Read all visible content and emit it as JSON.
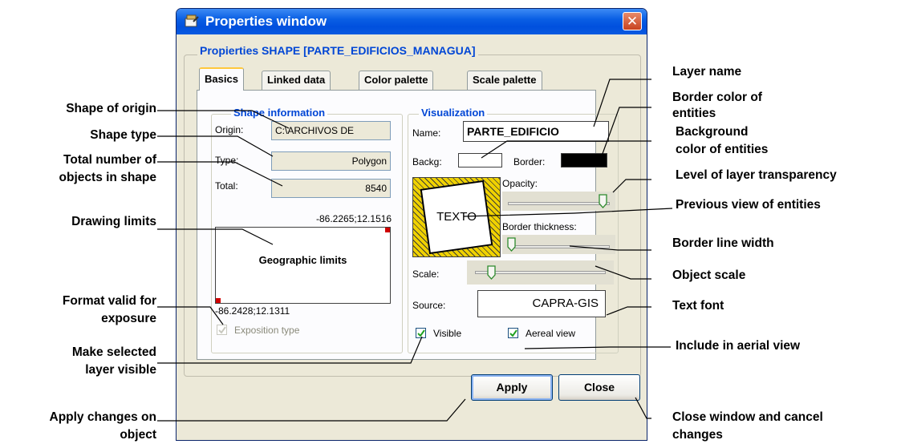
{
  "window": {
    "title": "Properties window",
    "close_symbol": "✕",
    "group_title": "Propierties SHAPE [PARTE_EDIFICIOS_MANAGUA]",
    "tabs": [
      {
        "label": "Basics",
        "active": true
      },
      {
        "label": "Linked data",
        "active": false
      },
      {
        "label": "Color palette",
        "active": false
      },
      {
        "label": "Scale palette",
        "active": false
      }
    ],
    "shape_info": {
      "title": "Shape information",
      "origin_label": "Origin:",
      "origin_value": "C:\\ARCHIVOS DE",
      "type_label": "Type:",
      "type_value": "Polygon",
      "total_label": "Total:",
      "total_value": "8540",
      "limit_max": "-86.2265;12.1516",
      "limit_box_label": "Geographic limits",
      "limit_min": "-86.2428;12.1311",
      "exposition_label": "Exposition type",
      "exposition_checked": true
    },
    "visualization": {
      "title": "Visualization",
      "name_label": "Name:",
      "name_value": "PARTE_EDIFICIO",
      "backg_label": "Backg:",
      "border_label": "Border:",
      "preview_text": "TEXTO",
      "opacity_label": "Opacity:",
      "opacity_level": 0.95,
      "border_thickness_label": "Border thickness:",
      "border_thickness_level": 0.0,
      "scale_label": "Scale:",
      "scale_level": 0.1,
      "source_label": "Source:",
      "source_value": "CAPRA-GIS",
      "visible_label": "Visible",
      "visible_checked": true,
      "aerial_label": "Aereal view",
      "aerial_checked": true
    },
    "buttons": {
      "apply": "Apply",
      "close": "Close"
    }
  },
  "annotations": {
    "shape_of_origin": "Shape of origin",
    "shape_type": "Shape type",
    "total_objects_1": "Total number of",
    "total_objects_2": "objects in shape",
    "drawing_limits": "Drawing limits",
    "format_valid_1": "Format valid for",
    "format_valid_2": "exposure",
    "make_visible_1": "Make selected",
    "make_visible_2": "layer visible",
    "apply_changes_1": "Apply changes on",
    "apply_changes_2": "object",
    "layer_name": "Layer name",
    "border_color_1": "Border color of",
    "border_color_2": "entities",
    "background_color_1": "Background",
    "background_color_2": "color of entities",
    "transparency": "Level of layer transparency",
    "previous_view": "Previous view of entities",
    "border_width": "Border line width",
    "object_scale": "Object scale",
    "text_font": "Text font",
    "aerial_view": "Include in aerial view",
    "close_window_1": "Close window and cancel",
    "close_window_2": "changes"
  },
  "colors": {
    "title_blue": "#0a5fe4",
    "group_title_blue": "#0046d5",
    "close_red": "#c8421f",
    "border_swatch": "#000000",
    "background_swatch": "#ffffff",
    "preview_stripe": "#f0d200",
    "corner_marker": "#d00000"
  }
}
